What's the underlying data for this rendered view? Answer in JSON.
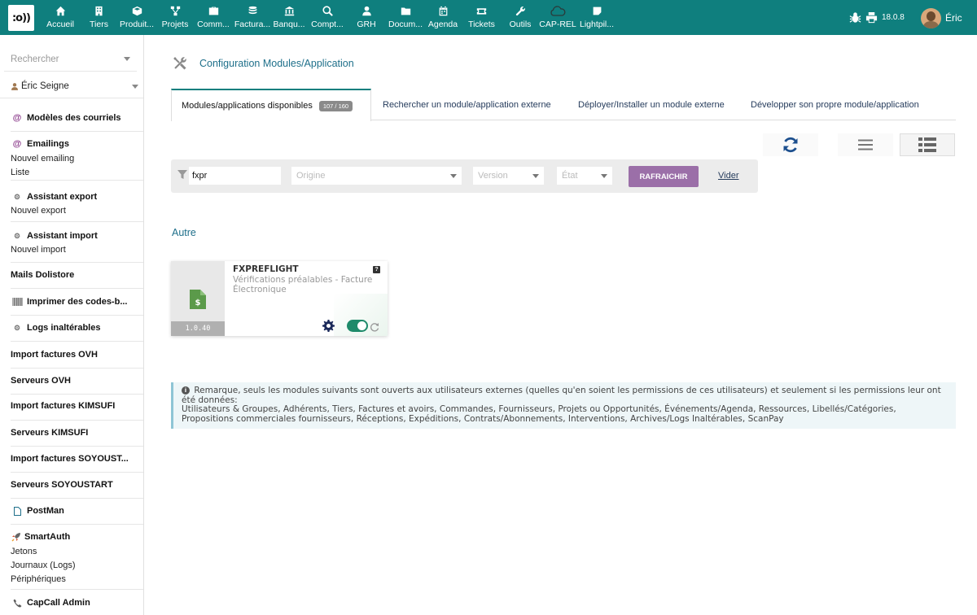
{
  "topbar": {
    "menu": [
      {
        "label": "Accueil",
        "icon": "home-icon"
      },
      {
        "label": "Tiers",
        "icon": "building-icon"
      },
      {
        "label": "Produit...",
        "icon": "cube-icon"
      },
      {
        "label": "Projets",
        "icon": "project-icon"
      },
      {
        "label": "Comm...",
        "icon": "briefcase-icon"
      },
      {
        "label": "Factura...",
        "icon": "coins-icon"
      },
      {
        "label": "Banqu...",
        "icon": "bank-icon"
      },
      {
        "label": "Compt...",
        "icon": "search-dollar-icon"
      },
      {
        "label": "GRH",
        "icon": "user-icon"
      },
      {
        "label": "Docum...",
        "icon": "folder-icon"
      },
      {
        "label": "Agenda",
        "icon": "calendar-icon"
      },
      {
        "label": "Tickets",
        "icon": "ticket-icon"
      },
      {
        "label": "Outils",
        "icon": "wrench-icon"
      },
      {
        "label": "CAP-REL",
        "icon": "cloud-icon"
      },
      {
        "label": "Lightpil...",
        "icon": "note-icon"
      }
    ],
    "version": "18.0.8",
    "username": "Éric"
  },
  "sidebar": {
    "search_placeholder": "Rechercher",
    "user": "Éric Seigne",
    "blocks": [
      {
        "title": "Modèles des courriels",
        "icon": "at-icon",
        "subs": []
      },
      {
        "title": "Emailings",
        "icon": "at-icon",
        "subs": [
          "Nouvel emailing",
          "Liste"
        ]
      },
      {
        "title": "Assistant export",
        "icon": "cogs-icon",
        "subs": [
          "Nouvel export"
        ]
      },
      {
        "title": "Assistant import",
        "icon": "cogs-icon",
        "subs": [
          "Nouvel import"
        ]
      },
      {
        "title": "Mails Dolistore",
        "icon": "",
        "subs": []
      },
      {
        "title": "Imprimer des codes-b...",
        "icon": "barcode-icon",
        "subs": []
      },
      {
        "title": "Logs inaltérables",
        "icon": "cogs-icon",
        "subs": []
      },
      {
        "title": "Import factures OVH",
        "icon": "",
        "subs": []
      },
      {
        "title": "Serveurs OVH",
        "icon": "",
        "subs": []
      },
      {
        "title": "Import factures KIMSUFI",
        "icon": "",
        "subs": []
      },
      {
        "title": "Serveurs KIMSUFI",
        "icon": "",
        "subs": []
      },
      {
        "title": "Import factures SOYOUST...",
        "icon": "",
        "subs": []
      },
      {
        "title": "Serveurs SOYOUSTART",
        "icon": "",
        "subs": []
      },
      {
        "title": "PostMan",
        "icon": "file-icon",
        "subs": []
      },
      {
        "title": "SmartAuth",
        "icon": "rocket-icon",
        "subs": [
          "Jetons",
          "Journaux (Logs)",
          "Périphériques"
        ]
      },
      {
        "title": "CapCall Admin",
        "icon": "phone-icon",
        "subs": []
      }
    ]
  },
  "main": {
    "title": "Configuration Modules/Application",
    "tabs": [
      {
        "label": "Modules/applications disponibles",
        "badge": "107 / 160"
      },
      {
        "label": "Rechercher un module/application externe"
      },
      {
        "label": "Déployer/Installer un module externe"
      },
      {
        "label": "Développer son propre module/application"
      }
    ],
    "filter": {
      "value": "fxpr",
      "origin_placeholder": "Origine",
      "version_placeholder": "Version",
      "state_placeholder": "État",
      "refresh_label": "RAFRAICHIR",
      "clear_label": "Vider"
    },
    "section": "Autre",
    "module": {
      "name": "FXPREFLIGHT",
      "description": "Vérifications préalables - Facture Électronique",
      "version": "1.0.40",
      "enabled": true,
      "help": "?"
    },
    "notice": {
      "icon": "i",
      "text": "Remarque, seuls les modules suivants sont ouverts aux utilisateurs externes (quelles qu'en soient les permissions de ces utilisateurs) et seulement si les permissions leur ont été données:",
      "list_line1": "Utilisateurs & Groupes, Adhérents, Tiers, Factures et avoirs, Commandes, Fournisseurs, Projets ou Opportunités, Événements/Agenda, Ressources, Libellés/Catégories,",
      "list_line2": "Propositions commerciales fournisseurs, Réceptions, Expéditions, Contrats/Abonnements, Interventions, Archives/Logs Inaltérables, ScanPay"
    }
  },
  "colors": {
    "topbar": "#0f7f7e",
    "button": "#9b6fa8",
    "title": "#1e6f8a",
    "toggle_on": "#1e8a6a"
  }
}
